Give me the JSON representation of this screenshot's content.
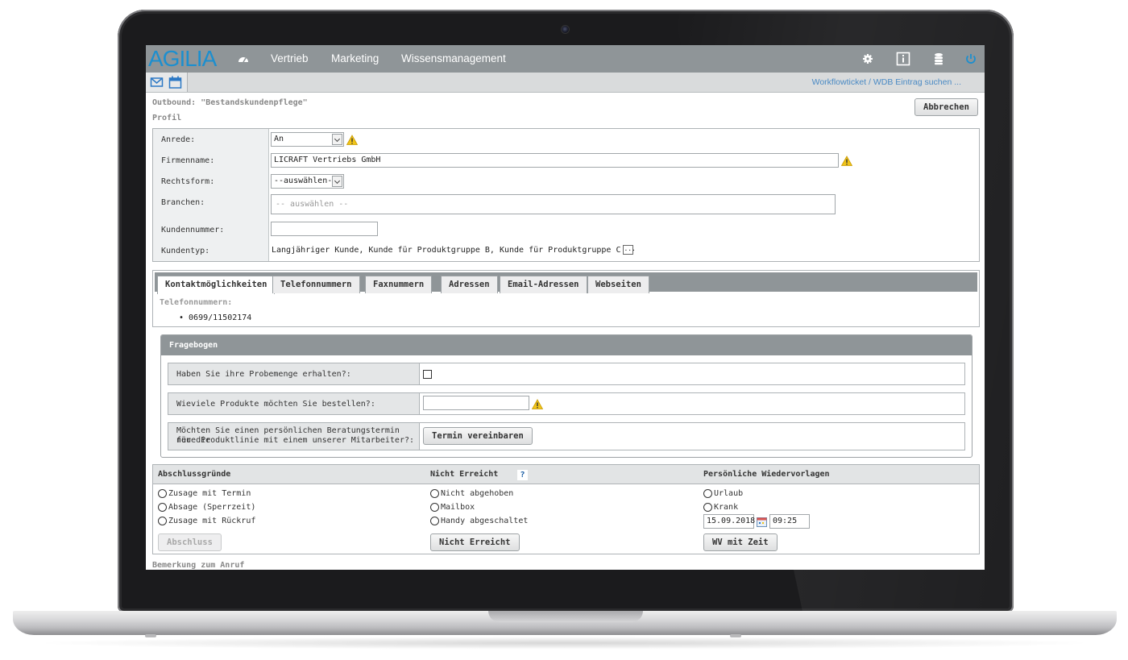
{
  "topbar": {
    "logo": "AGILIA",
    "nav": [
      "Vertrieb",
      "Marketing",
      "Wissensmanagement"
    ],
    "icons": [
      "dashboard-icon",
      "gear-icon",
      "info-icon",
      "database-icon",
      "power-icon"
    ]
  },
  "toolbar": {
    "icons": [
      "mail-icon",
      "calendar-icon"
    ],
    "link": "Workflowticket / WDB Eintrag suchen ..."
  },
  "header": {
    "title": "Outbound: \"Bestandskundenpflege\"",
    "subtitle": "Profil",
    "cancel": "Abbrechen"
  },
  "profile": {
    "anrede_label": "Anrede:",
    "anrede_value": "An",
    "firma_label": "Firmenname:",
    "firma_value": "LICRAFT Vertriebs GmbH",
    "rechtsform_label": "Rechtsform:",
    "rechtsform_value": "--auswählen--",
    "branchen_label": "Branchen:",
    "branchen_placeholder": "-- auswählen --",
    "kundennummer_label": "Kundennummer:",
    "kundennummer_value": "",
    "kundentyp_label": "Kundentyp:",
    "kundentyp_value": "Langjähriger Kunde, Kunde für Produktgruppe B, Kunde für Produktgruppe C",
    "ellipsis": "..."
  },
  "tabs": {
    "items": [
      "Kontaktmöglichkeiten",
      "Telefonnummern",
      "Faxnummern",
      "Adressen",
      "Email-Adressen",
      "Webseiten"
    ],
    "active_heading": "Telefonnummern:",
    "entries": [
      "• 0699/11502174"
    ]
  },
  "fragebogen": {
    "title": "Fragebogen",
    "q1": "Haben Sie ihre Probemenge erhalten?:",
    "q2": "Wieviele Produkte möchten Sie bestellen?:",
    "q3_line1": "Möchten Sie einen persönlichen Beratungstermin für die",
    "q3_line2": "neue Produktlinie mit einem unserer Mitarbeiter?:",
    "q3_button": "Termin vereinbaren"
  },
  "bottom": {
    "col1_title": "Abschlussgründe",
    "col1_options": [
      "Zusage mit Termin",
      "Absage (Sperrzeit)",
      "Zusage mit Rückruf"
    ],
    "col1_button": "Abschluss",
    "col2_title": "Nicht Erreicht",
    "col2_help": "?",
    "col2_options": [
      "Nicht abgehoben",
      "Mailbox",
      "Handy abgeschaltet"
    ],
    "col2_button": "Nicht Erreicht",
    "col3_title": "Persönliche Wiedervorlagen",
    "col3_options": [
      "Urlaub",
      "Krank"
    ],
    "date": "15.09.2018",
    "time": "09:25",
    "col3_button": "WV mit Zeit"
  },
  "remark": "Bemerkung zum Anruf",
  "colors": {
    "accent": "#1c8fcf",
    "bar": "#8f9598",
    "link": "#4a8ac4",
    "warning": "#f0c419"
  }
}
